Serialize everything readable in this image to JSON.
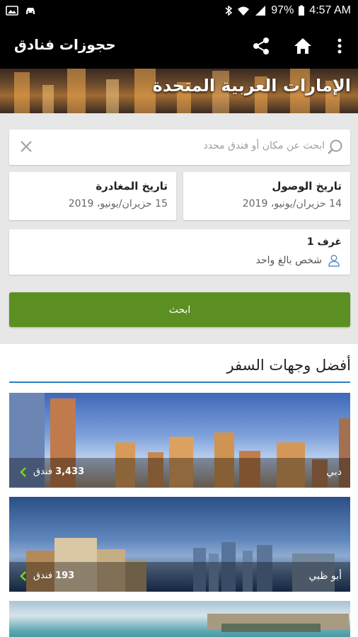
{
  "status_bar": {
    "battery": "97%",
    "time": "4:57 AM"
  },
  "app_bar": {
    "title": "حجوزات فنادق"
  },
  "hero": {
    "title": "الإمارات العربية المتحدة"
  },
  "search": {
    "placeholder": "ابحث عن مكان أو فندق محدد"
  },
  "dates": {
    "arrival_label": "تاريخ الوصول",
    "arrival_value": "14 حزيران/يونيو، 2019",
    "departure_label": "تاريخ المغادرة",
    "departure_value": "15 حزيران/يونيو، 2019"
  },
  "rooms": {
    "label": "غرف 1",
    "value": "شخص بالغ واحد"
  },
  "search_button": {
    "label": "ابحث"
  },
  "destinations": {
    "heading": "أفضل وجهات السفر",
    "items": [
      {
        "name": "دبي",
        "count": "3,433",
        "unit": "فندق"
      },
      {
        "name": "أبو ظبي",
        "count": "193",
        "unit": "فندق"
      }
    ]
  },
  "colors": {
    "accent_green": "#5c8f22",
    "accent_blue": "#2b7fc0"
  }
}
